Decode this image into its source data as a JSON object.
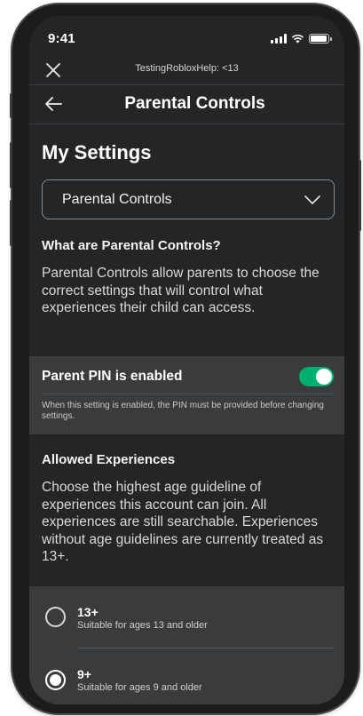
{
  "status_bar": {
    "time": "9:41",
    "icons": [
      "signal-icon",
      "wifi-icon",
      "battery-icon"
    ]
  },
  "topbar": {
    "title": "TestingRobloxHelp: <13",
    "close_icon": "close-icon"
  },
  "header": {
    "title": "Parental Controls",
    "back_icon": "arrow-left-icon"
  },
  "page": {
    "title": "My Settings"
  },
  "category_select": {
    "value": "Parental Controls",
    "icon": "chevron-down-icon"
  },
  "about": {
    "heading": "What are Parental Controls?",
    "body": "Parental Controls allow parents to choose the correct settings that will control what experiences their child can access."
  },
  "parent_pin": {
    "label": "Parent PIN is enabled",
    "enabled": true,
    "note": "When this setting is enabled, the PIN must be provided before changing settings."
  },
  "allowed_experiences": {
    "heading": "Allowed Experiences",
    "body": "Choose the highest age guideline of experiences this account can join. All experiences are still searchable. Experiences without age guidelines are currently treated as 13+.",
    "options": [
      {
        "label": "13+",
        "description": "Suitable for ages 13 and older",
        "selected": false
      },
      {
        "label": "9+",
        "description": "Suitable for ages 9 and older",
        "selected": true
      }
    ]
  },
  "colors": {
    "background": "#232527",
    "panel": "#393b3d",
    "toggle_on": "#00b06f",
    "text": "#ffffff"
  }
}
